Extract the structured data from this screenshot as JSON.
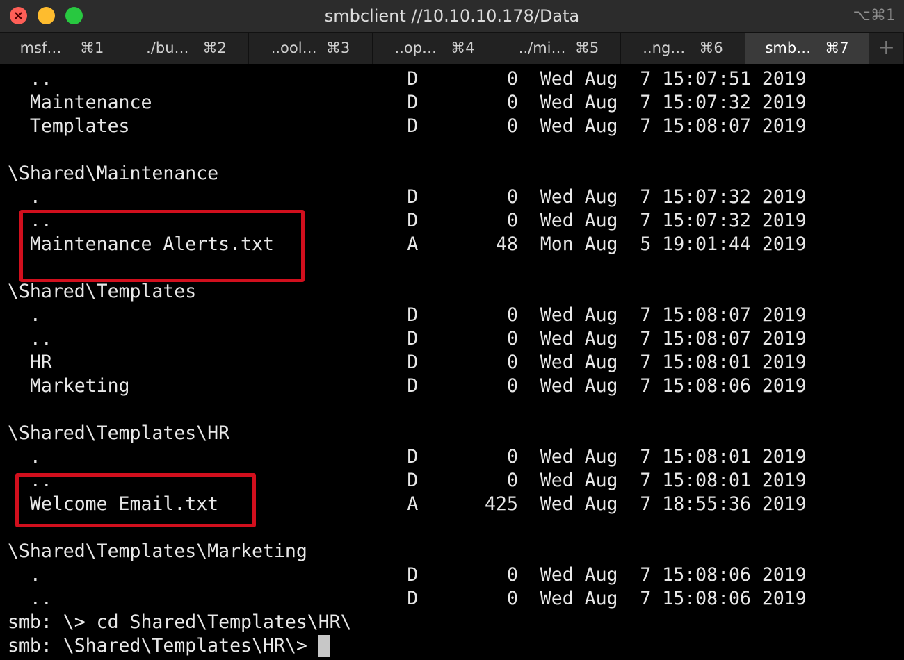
{
  "window": {
    "title": "smbclient //10.10.10.178/Data",
    "shortcut": "⌥⌘1"
  },
  "tabs": [
    {
      "label": "msf…    ⌘1"
    },
    {
      "label": "./bu…   ⌘2"
    },
    {
      "label": "..ool…  ⌘3"
    },
    {
      "label": "..op…   ⌘4"
    },
    {
      "label": "../mi…  ⌘5"
    },
    {
      "label": "..ng…   ⌘6"
    },
    {
      "label": "smb…   ⌘7"
    },
    {
      "label": "+"
    }
  ],
  "terminal": {
    "lines": [
      "  ..                                D        0  Wed Aug  7 15:07:51 2019",
      "  Maintenance                       D        0  Wed Aug  7 15:07:32 2019",
      "  Templates                         D        0  Wed Aug  7 15:08:07 2019",
      "",
      "\\Shared\\Maintenance",
      "  .                                 D        0  Wed Aug  7 15:07:32 2019",
      "  ..                                D        0  Wed Aug  7 15:07:32 2019",
      "  Maintenance Alerts.txt            A       48  Mon Aug  5 19:01:44 2019",
      "",
      "\\Shared\\Templates",
      "  .                                 D        0  Wed Aug  7 15:08:07 2019",
      "  ..                                D        0  Wed Aug  7 15:08:07 2019",
      "  HR                                D        0  Wed Aug  7 15:08:01 2019",
      "  Marketing                         D        0  Wed Aug  7 15:08:06 2019",
      "",
      "\\Shared\\Templates\\HR",
      "  .                                 D        0  Wed Aug  7 15:08:01 2019",
      "  ..                                D        0  Wed Aug  7 15:08:01 2019",
      "  Welcome Email.txt                 A      425  Wed Aug  7 18:55:36 2019",
      "",
      "\\Shared\\Templates\\Marketing",
      "  .                                 D        0  Wed Aug  7 15:08:06 2019",
      "  ..                                D        0  Wed Aug  7 15:08:06 2019",
      "smb: \\> cd Shared\\Templates\\HR\\",
      "smb: \\Shared\\Templates\\HR\\> "
    ]
  },
  "colors": {
    "highlight": "#d10f1d",
    "terminal_bg": "#000000",
    "terminal_fg": "#e8e8e8"
  }
}
